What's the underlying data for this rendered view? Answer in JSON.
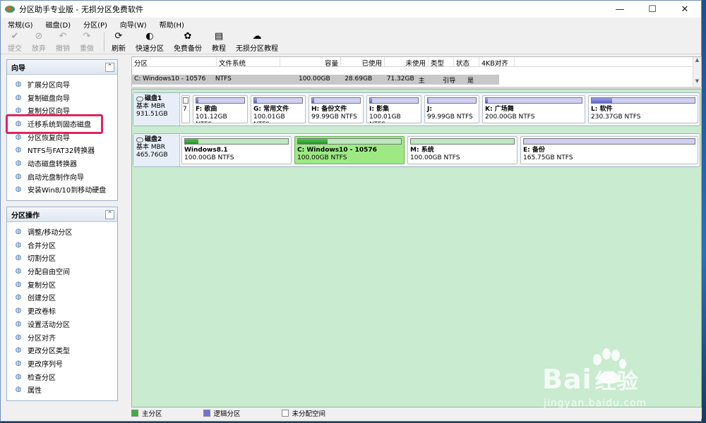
{
  "window": {
    "title": "分区助手专业版 - 无损分区免费软件",
    "controls": {
      "minimize": "—",
      "maximize": "☐",
      "close": "✕"
    }
  },
  "menu": [
    "常规(G)",
    "磁盘(D)",
    "分区(P)",
    "向导(W)",
    "帮助(H)"
  ],
  "toolbar": [
    {
      "label": "提交",
      "icon": "check-icon",
      "glyph": "✔",
      "enabled": false
    },
    {
      "label": "放弃",
      "icon": "discard-icon",
      "glyph": "⊘",
      "enabled": false
    },
    {
      "label": "撤销",
      "icon": "undo-icon",
      "glyph": "↶",
      "enabled": false
    },
    {
      "label": "重做",
      "icon": "redo-icon",
      "glyph": "↷",
      "enabled": false
    },
    {
      "label": "刷新",
      "icon": "refresh-icon",
      "glyph": "⟳",
      "enabled": true
    },
    {
      "label": "快速分区",
      "icon": "quick-partition-icon",
      "glyph": "◐",
      "enabled": true
    },
    {
      "label": "免费备份",
      "icon": "backup-icon",
      "glyph": "✿",
      "enabled": true
    },
    {
      "label": "教程",
      "icon": "tutorial-icon",
      "glyph": "▤",
      "enabled": true
    },
    {
      "label": "无损分区教程",
      "icon": "lossless-tutorial-icon",
      "glyph": "☁",
      "enabled": true
    }
  ],
  "wizard_panel": {
    "title": "向导",
    "items": [
      "扩展分区向导",
      "复制磁盘向导",
      "复制分区向导",
      "迁移系统到固态磁盘",
      "分区恢复向导",
      "NTFS与FAT32转换器",
      "动态磁盘转换器",
      "启动光盘制作向导",
      "安装Win8/10到移动硬盘"
    ]
  },
  "ops_panel": {
    "title": "分区操作",
    "items": [
      "调整/移动分区",
      "合并分区",
      "切割分区",
      "分配自由空间",
      "复制分区",
      "创建分区",
      "更改卷标",
      "设置活动分区",
      "分区对齐",
      "更改分区类型",
      "更改序列号",
      "检查分区",
      "属性"
    ]
  },
  "table": {
    "columns": [
      "分区",
      "文件系统",
      "容量",
      "已使用",
      "未使用",
      "类型",
      "状态",
      "4KB对齐"
    ],
    "row": [
      "C: Windows10 - 10576",
      "NTFS",
      "100.00GB",
      "28.69GB",
      "71.32GB",
      "主",
      "引导",
      "是"
    ]
  },
  "disks": [
    {
      "name": "磁盘1",
      "type": "基本 MBR",
      "size": "931.51GB",
      "partitions": [
        {
          "label": "7",
          "name": "",
          "size": "",
          "kind": "tiny",
          "used": 0
        },
        {
          "name": "F: 歌曲",
          "size": "101.12GB NTFS",
          "kind": "logic",
          "used": 0.05
        },
        {
          "name": "G: 常用文件",
          "size": "100.01GB NTFS",
          "kind": "logic",
          "used": 0.06
        },
        {
          "name": "H: 备份文件",
          "size": "99.99GB NTFS",
          "kind": "logic",
          "used": 0.04
        },
        {
          "name": "I: 影集",
          "size": "100.01GB NTFS",
          "kind": "logic",
          "used": 0.05
        },
        {
          "name": "J:",
          "size": "99.99GB NTFS",
          "kind": "logic",
          "used": 0.02
        },
        {
          "name": "K: 广场舞",
          "size": "200.00GB NTFS",
          "kind": "logic",
          "used": 0.02
        },
        {
          "name": "L: 软件",
          "size": "230.37GB NTFS",
          "kind": "logic",
          "used": 0.2
        }
      ]
    },
    {
      "name": "磁盘2",
      "type": "基本 MBR",
      "size": "465.76GB",
      "partitions": [
        {
          "name": "Windows8.1",
          "size": "100.00GB NTFS",
          "kind": "primary",
          "used": 0.13
        },
        {
          "name": "C: Windows10 - 10576",
          "size": "100.00GB NTFS",
          "kind": "primary",
          "used": 0.29,
          "selected": true
        },
        {
          "name": "M: 系统",
          "size": "100.00GB NTFS",
          "kind": "primary",
          "used": 0.0
        },
        {
          "name": "E: 备份",
          "size": "165.75GB NTFS",
          "kind": "logic",
          "used": 0.0
        }
      ]
    }
  ],
  "legend": [
    {
      "label": "主分区",
      "color": "#3fae3f"
    },
    {
      "label": "逻辑分区",
      "color": "#6f74d1"
    },
    {
      "label": "未分配空间",
      "color": "#ffffff"
    }
  ],
  "watermark": {
    "brand": "Bai",
    "suffix": "经验",
    "url": "jingyan.baidu.com"
  },
  "colors": {
    "accent_highlight": "#e0245e",
    "area_bg": "#c9ebcf",
    "selected_partition": "#9dea84"
  }
}
